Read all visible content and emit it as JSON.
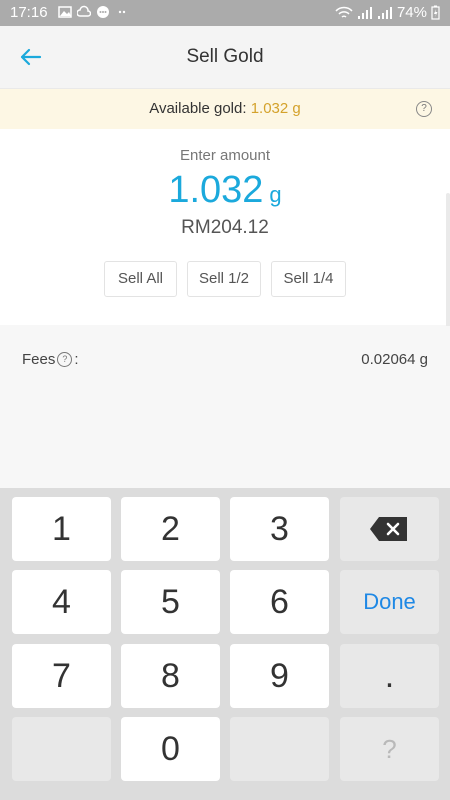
{
  "status_bar": {
    "time": "17:16",
    "battery": "74%"
  },
  "app_bar": {
    "title": "Sell Gold"
  },
  "banner": {
    "label": "Available gold:",
    "value": "1.032 g"
  },
  "amount": {
    "label": "Enter amount",
    "value": "1.032",
    "unit": "g",
    "rm": "RM204.12"
  },
  "sell_options": [
    {
      "label": "Sell All"
    },
    {
      "label": "Sell 1/2"
    },
    {
      "label": "Sell 1/4"
    }
  ],
  "fees": {
    "label": "Fees",
    "help_symbol": "?",
    "colon": ":",
    "value": "0.02064 g"
  },
  "keypad": {
    "keys": [
      "1",
      "2",
      "3",
      "4",
      "5",
      "6",
      "7",
      "8",
      "9",
      ".",
      "0",
      "?"
    ],
    "done": "Done"
  },
  "colors": {
    "accent": "#1ba9dc",
    "gold": "#d4a22b",
    "banner_bg": "#fdf7e4",
    "done": "#1e88e5"
  }
}
